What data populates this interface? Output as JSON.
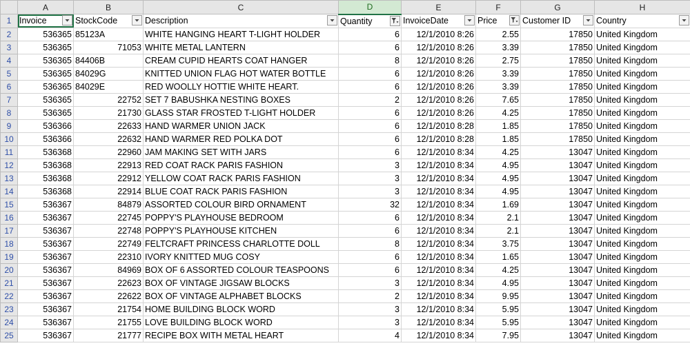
{
  "columns": [
    {
      "letter": "A",
      "header": "Invoice",
      "align": "r",
      "filtered": false
    },
    {
      "letter": "B",
      "header": "StockCode",
      "align": "r",
      "filtered": false
    },
    {
      "letter": "C",
      "header": "Description",
      "align": "l",
      "filtered": false
    },
    {
      "letter": "D",
      "header": "Quantity",
      "align": "r",
      "filtered": true
    },
    {
      "letter": "E",
      "header": "InvoiceDate",
      "align": "r",
      "filtered": false
    },
    {
      "letter": "F",
      "header": "Price",
      "align": "r",
      "filtered": true
    },
    {
      "letter": "G",
      "header": "Customer ID",
      "align": "r",
      "filtered": false
    },
    {
      "letter": "H",
      "header": "Country",
      "align": "l",
      "filtered": false
    }
  ],
  "selected_column": "D",
  "active_cell": "A1",
  "header_row_number": "1",
  "rows": [
    {
      "n": "2",
      "cells": [
        "536365",
        "85123A",
        "WHITE HANGING HEART T-LIGHT HOLDER",
        "6",
        "12/1/2010 8:26",
        "2.55",
        "17850",
        "United Kingdom"
      ]
    },
    {
      "n": "3",
      "cells": [
        "536365",
        "71053",
        "WHITE METAL LANTERN",
        "6",
        "12/1/2010 8:26",
        "3.39",
        "17850",
        "United Kingdom"
      ]
    },
    {
      "n": "4",
      "cells": [
        "536365",
        "84406B",
        "CREAM CUPID HEARTS COAT HANGER",
        "8",
        "12/1/2010 8:26",
        "2.75",
        "17850",
        "United Kingdom"
      ]
    },
    {
      "n": "5",
      "cells": [
        "536365",
        "84029G",
        "KNITTED UNION FLAG HOT WATER BOTTLE",
        "6",
        "12/1/2010 8:26",
        "3.39",
        "17850",
        "United Kingdom"
      ]
    },
    {
      "n": "6",
      "cells": [
        "536365",
        "84029E",
        "RED WOOLLY HOTTIE WHITE HEART.",
        "6",
        "12/1/2010 8:26",
        "3.39",
        "17850",
        "United Kingdom"
      ]
    },
    {
      "n": "7",
      "cells": [
        "536365",
        "22752",
        "SET 7 BABUSHKA NESTING BOXES",
        "2",
        "12/1/2010 8:26",
        "7.65",
        "17850",
        "United Kingdom"
      ]
    },
    {
      "n": "8",
      "cells": [
        "536365",
        "21730",
        "GLASS STAR FROSTED T-LIGHT HOLDER",
        "6",
        "12/1/2010 8:26",
        "4.25",
        "17850",
        "United Kingdom"
      ]
    },
    {
      "n": "9",
      "cells": [
        "536366",
        "22633",
        "HAND WARMER UNION JACK",
        "6",
        "12/1/2010 8:28",
        "1.85",
        "17850",
        "United Kingdom"
      ]
    },
    {
      "n": "10",
      "cells": [
        "536366",
        "22632",
        "HAND WARMER RED POLKA DOT",
        "6",
        "12/1/2010 8:28",
        "1.85",
        "17850",
        "United Kingdom"
      ]
    },
    {
      "n": "11",
      "cells": [
        "536368",
        "22960",
        "JAM MAKING SET WITH JARS",
        "6",
        "12/1/2010 8:34",
        "4.25",
        "13047",
        "United Kingdom"
      ]
    },
    {
      "n": "12",
      "cells": [
        "536368",
        "22913",
        "RED COAT RACK PARIS FASHION",
        "3",
        "12/1/2010 8:34",
        "4.95",
        "13047",
        "United Kingdom"
      ]
    },
    {
      "n": "13",
      "cells": [
        "536368",
        "22912",
        "YELLOW COAT RACK PARIS FASHION",
        "3",
        "12/1/2010 8:34",
        "4.95",
        "13047",
        "United Kingdom"
      ]
    },
    {
      "n": "14",
      "cells": [
        "536368",
        "22914",
        "BLUE COAT RACK PARIS FASHION",
        "3",
        "12/1/2010 8:34",
        "4.95",
        "13047",
        "United Kingdom"
      ]
    },
    {
      "n": "15",
      "cells": [
        "536367",
        "84879",
        "ASSORTED COLOUR BIRD ORNAMENT",
        "32",
        "12/1/2010 8:34",
        "1.69",
        "13047",
        "United Kingdom"
      ]
    },
    {
      "n": "16",
      "cells": [
        "536367",
        "22745",
        "POPPY'S PLAYHOUSE BEDROOM",
        "6",
        "12/1/2010 8:34",
        "2.1",
        "13047",
        "United Kingdom"
      ]
    },
    {
      "n": "17",
      "cells": [
        "536367",
        "22748",
        "POPPY'S PLAYHOUSE KITCHEN",
        "6",
        "12/1/2010 8:34",
        "2.1",
        "13047",
        "United Kingdom"
      ]
    },
    {
      "n": "18",
      "cells": [
        "536367",
        "22749",
        "FELTCRAFT PRINCESS CHARLOTTE DOLL",
        "8",
        "12/1/2010 8:34",
        "3.75",
        "13047",
        "United Kingdom"
      ]
    },
    {
      "n": "19",
      "cells": [
        "536367",
        "22310",
        "IVORY KNITTED MUG COSY",
        "6",
        "12/1/2010 8:34",
        "1.65",
        "13047",
        "United Kingdom"
      ]
    },
    {
      "n": "20",
      "cells": [
        "536367",
        "84969",
        "BOX OF 6 ASSORTED COLOUR TEASPOONS",
        "6",
        "12/1/2010 8:34",
        "4.25",
        "13047",
        "United Kingdom"
      ]
    },
    {
      "n": "21",
      "cells": [
        "536367",
        "22623",
        "BOX OF VINTAGE JIGSAW BLOCKS",
        "3",
        "12/1/2010 8:34",
        "4.95",
        "13047",
        "United Kingdom"
      ]
    },
    {
      "n": "22",
      "cells": [
        "536367",
        "22622",
        "BOX OF VINTAGE ALPHABET BLOCKS",
        "2",
        "12/1/2010 8:34",
        "9.95",
        "13047",
        "United Kingdom"
      ]
    },
    {
      "n": "23",
      "cells": [
        "536367",
        "21754",
        "HOME BUILDING BLOCK WORD",
        "3",
        "12/1/2010 8:34",
        "5.95",
        "13047",
        "United Kingdom"
      ]
    },
    {
      "n": "24",
      "cells": [
        "536367",
        "21755",
        "LOVE BUILDING BLOCK WORD",
        "3",
        "12/1/2010 8:34",
        "5.95",
        "13047",
        "United Kingdom"
      ]
    },
    {
      "n": "25",
      "cells": [
        "536367",
        "21777",
        "RECIPE BOX WITH METAL HEART",
        "4",
        "12/1/2010 8:34",
        "7.95",
        "13047",
        "United Kingdom"
      ]
    }
  ],
  "icons": {
    "filter_dropdown": "chevron-down-icon",
    "filter_applied": "filter-funnel-icon"
  },
  "colors": {
    "selection_green": "#217346",
    "header_gray": "#e6e6e6",
    "row_number_blue": "#2f4fa8"
  }
}
